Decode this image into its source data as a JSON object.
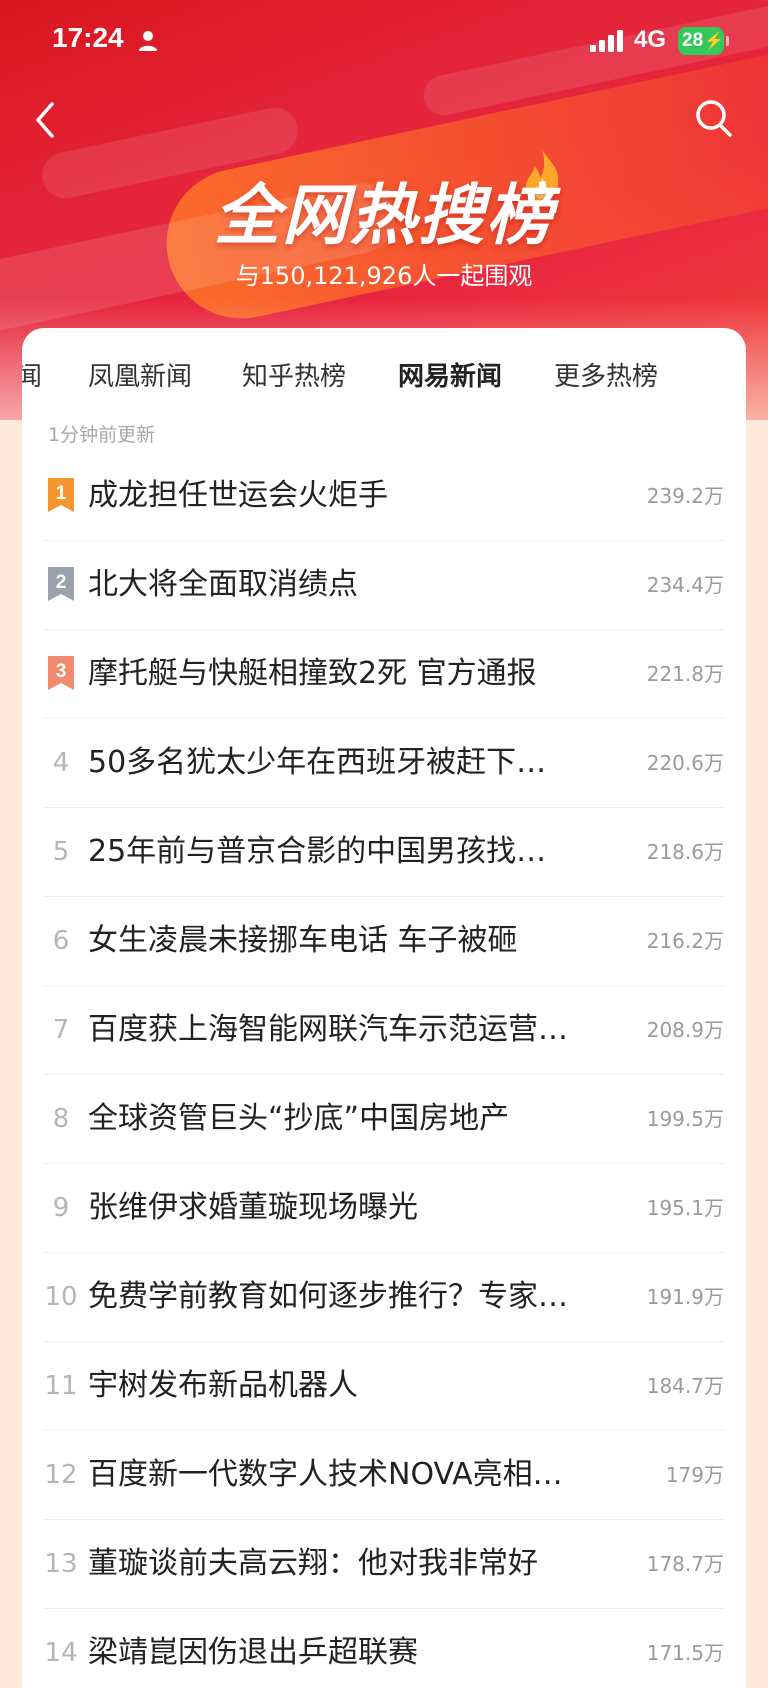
{
  "status_bar": {
    "time": "17:24",
    "network": "4G",
    "battery": "28"
  },
  "header": {
    "title": "全网热搜榜",
    "subtitle": "与150,121,926人一起围观"
  },
  "tabs": [
    "闻",
    "凤凰新闻",
    "知乎热榜",
    "网易新闻",
    "更多热榜"
  ],
  "active_tab": "网易新闻",
  "updated_text": "1分钟前更新",
  "badge_colors": {
    "1": "#f5962f",
    "2": "#9aa3ad",
    "3": "#f08a6d"
  },
  "items": [
    {
      "rank": "1",
      "title": "成龙担任世运会火炬手",
      "heat": "239.2万"
    },
    {
      "rank": "2",
      "title": "北大将全面取消绩点",
      "heat": "234.4万"
    },
    {
      "rank": "3",
      "title": "摩托艇与快艇相撞致2死 官方通报",
      "heat": "221.8万"
    },
    {
      "rank": "4",
      "title": "50多名犹太少年在西班牙被赶下…",
      "heat": "220.6万"
    },
    {
      "rank": "5",
      "title": "25年前与普京合影的中国男孩找…",
      "heat": "218.6万"
    },
    {
      "rank": "6",
      "title": "女生凌晨未接挪车电话 车子被砸",
      "heat": "216.2万"
    },
    {
      "rank": "7",
      "title": "百度获上海智能网联汽车示范运营…",
      "heat": "208.9万"
    },
    {
      "rank": "8",
      "title": "全球资管巨头“抄底”中国房地产",
      "heat": "199.5万"
    },
    {
      "rank": "9",
      "title": "张维伊求婚董璇现场曝光",
      "heat": "195.1万"
    },
    {
      "rank": "10",
      "title": "免费学前教育如何逐步推行？专家…",
      "heat": "191.9万"
    },
    {
      "rank": "11",
      "title": "宇树发布新品机器人",
      "heat": "184.7万"
    },
    {
      "rank": "12",
      "title": "百度新一代数字人技术NOVA亮相…",
      "heat": "179万"
    },
    {
      "rank": "13",
      "title": "董璇谈前夫高云翔：他对我非常好",
      "heat": "178.7万"
    },
    {
      "rank": "14",
      "title": "梁靖崑因伤退出乒超联赛",
      "heat": "171.5万"
    }
  ]
}
